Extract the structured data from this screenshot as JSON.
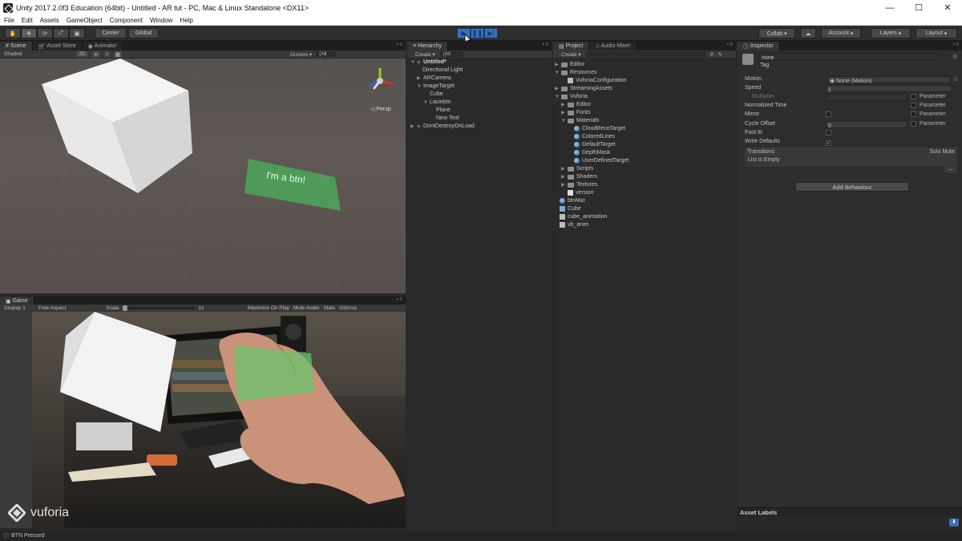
{
  "window": {
    "title": "Unity 2017.2.0f3 Education (64bit) - Untitled - AR tut - PC, Mac & Linux Standalone <DX11>",
    "minimize": "—",
    "maximize": "☐",
    "close": "✕"
  },
  "menu": [
    "File",
    "Edit",
    "Assets",
    "GameObject",
    "Component",
    "Window",
    "Help"
  ],
  "toolbar": {
    "pivot": "Center",
    "space": "Global",
    "collab": "Collab ▾",
    "account": "Account",
    "layers": "Layers",
    "layout": "Layout",
    "play_state": "playing"
  },
  "scene_panel": {
    "tabs": [
      "Scene",
      "Asset Store",
      "Animator"
    ],
    "shading": "Shaded",
    "mode_2d": "2D",
    "gizmos": "Gizmos ▾",
    "search": "(All",
    "persp": "Persp",
    "button_text": "I'm a btn!"
  },
  "game_panel": {
    "tab": "Game",
    "display": "Display 1",
    "aspect": "Free Aspect",
    "scale_label": "Scale",
    "scale_value": "1x",
    "options": [
      "Maximize On Play",
      "Mute Audio",
      "Stats",
      "Gizmos"
    ],
    "watermark": "vuforia"
  },
  "hierarchy": {
    "tab": "Hierarchy",
    "create": "Create",
    "search": "(All",
    "items": [
      {
        "label": "Untitled*",
        "depth": 0
      },
      {
        "label": "Directional Light",
        "depth": 1
      },
      {
        "label": "ARCamera",
        "depth": 1
      },
      {
        "label": "ImageTarget",
        "depth": 1
      },
      {
        "label": "Cube",
        "depth": 2
      },
      {
        "label": "Laciebtn",
        "depth": 2
      },
      {
        "label": "Plane",
        "depth": 3
      },
      {
        "label": "New Text",
        "depth": 3
      },
      {
        "label": "DontDestroyOnLoad",
        "depth": 0
      }
    ]
  },
  "project": {
    "tabs": [
      "Project",
      "Audio Mixer"
    ],
    "create": "Create",
    "items": [
      {
        "label": "Editor",
        "kind": "folder",
        "depth": 0
      },
      {
        "label": "Resources",
        "kind": "folder",
        "depth": 0
      },
      {
        "label": "VuforiaConfiguration",
        "kind": "file",
        "depth": 1
      },
      {
        "label": "StreamingAssets",
        "kind": "folder",
        "depth": 0
      },
      {
        "label": "Vuforia",
        "kind": "folder",
        "depth": 0
      },
      {
        "label": "Editor",
        "kind": "folder",
        "depth": 1
      },
      {
        "label": "Fonts",
        "kind": "folder",
        "depth": 1
      },
      {
        "label": "Materials",
        "kind": "folder",
        "depth": 1
      },
      {
        "label": "CloudRecoTarget",
        "kind": "material",
        "depth": 2
      },
      {
        "label": "ColoredLines",
        "kind": "material",
        "depth": 2
      },
      {
        "label": "DefaultTarget",
        "kind": "material",
        "depth": 2
      },
      {
        "label": "DepthMask",
        "kind": "material",
        "depth": 2
      },
      {
        "label": "UserDefinedTarget",
        "kind": "material",
        "depth": 2
      },
      {
        "label": "Scripts",
        "kind": "folder",
        "depth": 1
      },
      {
        "label": "Shaders",
        "kind": "folder",
        "depth": 1
      },
      {
        "label": "Textures",
        "kind": "folder",
        "depth": 1
      },
      {
        "label": "version",
        "kind": "file",
        "depth": 1
      },
      {
        "label": "btnMat",
        "kind": "material",
        "depth": 0
      },
      {
        "label": "Cube",
        "kind": "prefab",
        "depth": 0
      },
      {
        "label": "cube_animation",
        "kind": "file",
        "depth": 0
      },
      {
        "label": "vb_anim",
        "kind": "file",
        "depth": 0
      }
    ]
  },
  "inspector": {
    "tab": "Inspector",
    "name": "none",
    "tag": "Tag",
    "motion_label": "Motion",
    "motion_value": "None (Motion)",
    "speed_label": "Speed",
    "speed_value": "1",
    "multiplier_label": "Multiplier",
    "normalized_time_label": "Normalized Time",
    "mirror_label": "Mirror",
    "cycle_offset_label": "Cycle Offset",
    "cycle_offset_value": "0",
    "foot_ik_label": "Foot IK",
    "write_defaults_label": "Write Defaults",
    "parameter_label": "Parameter",
    "transitions_label": "Transitions",
    "solo_mute": "Solo Mute",
    "list_empty": "List is Empty",
    "add_behaviour": "Add Behaviour",
    "asset_labels": "Asset Labels"
  },
  "status": {
    "message": "BTN Pressed"
  }
}
